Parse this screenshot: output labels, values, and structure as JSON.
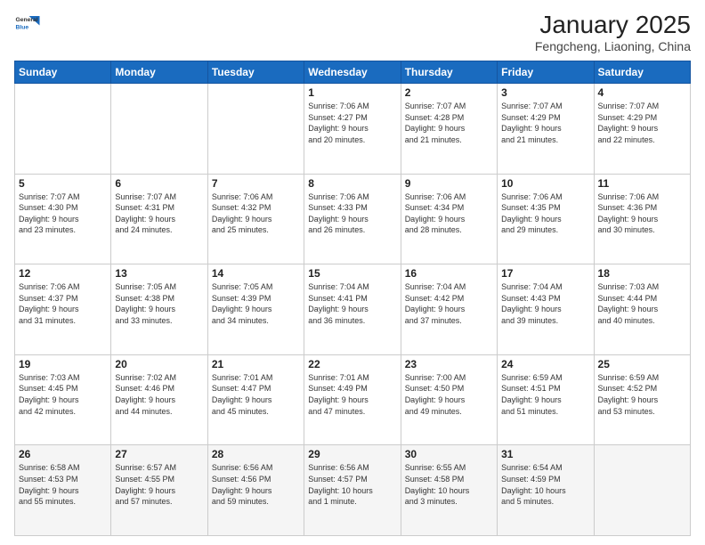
{
  "header": {
    "logo_general": "General",
    "logo_blue": "Blue",
    "month": "January 2025",
    "location": "Fengcheng, Liaoning, China"
  },
  "weekdays": [
    "Sunday",
    "Monday",
    "Tuesday",
    "Wednesday",
    "Thursday",
    "Friday",
    "Saturday"
  ],
  "weeks": [
    [
      {
        "day": "",
        "info": ""
      },
      {
        "day": "",
        "info": ""
      },
      {
        "day": "",
        "info": ""
      },
      {
        "day": "1",
        "info": "Sunrise: 7:06 AM\nSunset: 4:27 PM\nDaylight: 9 hours\nand 20 minutes."
      },
      {
        "day": "2",
        "info": "Sunrise: 7:07 AM\nSunset: 4:28 PM\nDaylight: 9 hours\nand 21 minutes."
      },
      {
        "day": "3",
        "info": "Sunrise: 7:07 AM\nSunset: 4:29 PM\nDaylight: 9 hours\nand 21 minutes."
      },
      {
        "day": "4",
        "info": "Sunrise: 7:07 AM\nSunset: 4:29 PM\nDaylight: 9 hours\nand 22 minutes."
      }
    ],
    [
      {
        "day": "5",
        "info": "Sunrise: 7:07 AM\nSunset: 4:30 PM\nDaylight: 9 hours\nand 23 minutes."
      },
      {
        "day": "6",
        "info": "Sunrise: 7:07 AM\nSunset: 4:31 PM\nDaylight: 9 hours\nand 24 minutes."
      },
      {
        "day": "7",
        "info": "Sunrise: 7:06 AM\nSunset: 4:32 PM\nDaylight: 9 hours\nand 25 minutes."
      },
      {
        "day": "8",
        "info": "Sunrise: 7:06 AM\nSunset: 4:33 PM\nDaylight: 9 hours\nand 26 minutes."
      },
      {
        "day": "9",
        "info": "Sunrise: 7:06 AM\nSunset: 4:34 PM\nDaylight: 9 hours\nand 28 minutes."
      },
      {
        "day": "10",
        "info": "Sunrise: 7:06 AM\nSunset: 4:35 PM\nDaylight: 9 hours\nand 29 minutes."
      },
      {
        "day": "11",
        "info": "Sunrise: 7:06 AM\nSunset: 4:36 PM\nDaylight: 9 hours\nand 30 minutes."
      }
    ],
    [
      {
        "day": "12",
        "info": "Sunrise: 7:06 AM\nSunset: 4:37 PM\nDaylight: 9 hours\nand 31 minutes."
      },
      {
        "day": "13",
        "info": "Sunrise: 7:05 AM\nSunset: 4:38 PM\nDaylight: 9 hours\nand 33 minutes."
      },
      {
        "day": "14",
        "info": "Sunrise: 7:05 AM\nSunset: 4:39 PM\nDaylight: 9 hours\nand 34 minutes."
      },
      {
        "day": "15",
        "info": "Sunrise: 7:04 AM\nSunset: 4:41 PM\nDaylight: 9 hours\nand 36 minutes."
      },
      {
        "day": "16",
        "info": "Sunrise: 7:04 AM\nSunset: 4:42 PM\nDaylight: 9 hours\nand 37 minutes."
      },
      {
        "day": "17",
        "info": "Sunrise: 7:04 AM\nSunset: 4:43 PM\nDaylight: 9 hours\nand 39 minutes."
      },
      {
        "day": "18",
        "info": "Sunrise: 7:03 AM\nSunset: 4:44 PM\nDaylight: 9 hours\nand 40 minutes."
      }
    ],
    [
      {
        "day": "19",
        "info": "Sunrise: 7:03 AM\nSunset: 4:45 PM\nDaylight: 9 hours\nand 42 minutes."
      },
      {
        "day": "20",
        "info": "Sunrise: 7:02 AM\nSunset: 4:46 PM\nDaylight: 9 hours\nand 44 minutes."
      },
      {
        "day": "21",
        "info": "Sunrise: 7:01 AM\nSunset: 4:47 PM\nDaylight: 9 hours\nand 45 minutes."
      },
      {
        "day": "22",
        "info": "Sunrise: 7:01 AM\nSunset: 4:49 PM\nDaylight: 9 hours\nand 47 minutes."
      },
      {
        "day": "23",
        "info": "Sunrise: 7:00 AM\nSunset: 4:50 PM\nDaylight: 9 hours\nand 49 minutes."
      },
      {
        "day": "24",
        "info": "Sunrise: 6:59 AM\nSunset: 4:51 PM\nDaylight: 9 hours\nand 51 minutes."
      },
      {
        "day": "25",
        "info": "Sunrise: 6:59 AM\nSunset: 4:52 PM\nDaylight: 9 hours\nand 53 minutes."
      }
    ],
    [
      {
        "day": "26",
        "info": "Sunrise: 6:58 AM\nSunset: 4:53 PM\nDaylight: 9 hours\nand 55 minutes."
      },
      {
        "day": "27",
        "info": "Sunrise: 6:57 AM\nSunset: 4:55 PM\nDaylight: 9 hours\nand 57 minutes."
      },
      {
        "day": "28",
        "info": "Sunrise: 6:56 AM\nSunset: 4:56 PM\nDaylight: 9 hours\nand 59 minutes."
      },
      {
        "day": "29",
        "info": "Sunrise: 6:56 AM\nSunset: 4:57 PM\nDaylight: 10 hours\nand 1 minute."
      },
      {
        "day": "30",
        "info": "Sunrise: 6:55 AM\nSunset: 4:58 PM\nDaylight: 10 hours\nand 3 minutes."
      },
      {
        "day": "31",
        "info": "Sunrise: 6:54 AM\nSunset: 4:59 PM\nDaylight: 10 hours\nand 5 minutes."
      },
      {
        "day": "",
        "info": ""
      }
    ]
  ]
}
